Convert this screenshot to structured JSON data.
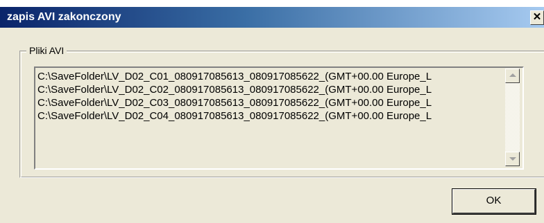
{
  "window": {
    "title": "zapis AVI zakonczony",
    "close_label": "✕"
  },
  "group": {
    "label": "Pliki AVI"
  },
  "files": [
    "C:\\SaveFolder\\LV_D02_C01_080917085613_080917085622_(GMT+00.00 Europe_L",
    "C:\\SaveFolder\\LV_D02_C02_080917085613_080917085622_(GMT+00.00 Europe_L",
    "C:\\SaveFolder\\LV_D02_C03_080917085613_080917085622_(GMT+00.00 Europe_L",
    "C:\\SaveFolder\\LV_D02_C04_080917085613_080917085622_(GMT+00.00 Europe_L"
  ],
  "buttons": {
    "ok_label": "OK"
  },
  "icons": {
    "scroll_up": "scroll-up-arrow-icon",
    "scroll_down": "scroll-down-arrow-icon",
    "close": "close-icon"
  },
  "colors": {
    "titlebar_start": "#0a246a",
    "titlebar_end": "#a6caf0",
    "face": "#ece9d8"
  }
}
